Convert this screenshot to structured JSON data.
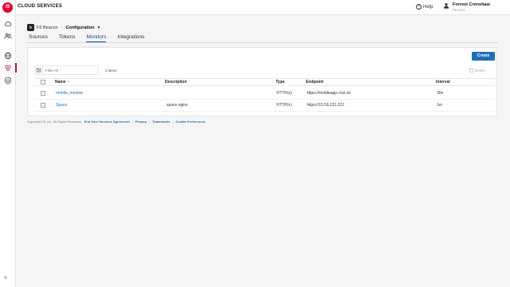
{
  "topbar": {
    "brand": "CLOUD SERVICES",
    "help_label": "Help",
    "user_name": "Forrest Crenshaw",
    "user_org": "F5 Acct"
  },
  "rail": {
    "logo_text": "f5",
    "icons": [
      "cloud-icon",
      "users-icon",
      "globe-icon",
      "beacon-icon",
      "shield-icon"
    ],
    "expand_label": "»"
  },
  "breadcrumb": {
    "product": "F5 Beacon",
    "section": "Configuration"
  },
  "tabs": [
    "Sources",
    "Tokens",
    "Monitors",
    "Integrations"
  ],
  "active_tab": "Monitors",
  "toolbar": {
    "create_label": "Create",
    "filter_placeholder": "Filter All",
    "item_count": "2 items",
    "delete_label": "Delete"
  },
  "table": {
    "columns": [
      "Name",
      "Description",
      "Type",
      "Endpoint",
      "Interval"
    ],
    "sort_indicator": "↑",
    "rows": [
      {
        "name": "mobile_monitor",
        "description": "",
        "type": "HTTP(s)",
        "endpoint": "https://mobileapp.r.ksi.io/",
        "interval": "30s"
      },
      {
        "name": "Space",
        "description": "space.nginx",
        "type": "HTTP(s)",
        "endpoint": "https://13.59.231.222",
        "interval": "1m"
      }
    ]
  },
  "footer": {
    "copyright": "Copyright F5, Inc. All Rights Reserved.",
    "links": [
      "End User Services Agreement",
      "Privacy",
      "Trademarks",
      "Cookie Preferences"
    ]
  },
  "colors": {
    "brand_red": "#e4002b",
    "accent_blue": "#1f6fb5",
    "active_tab": "#0b4f8a"
  }
}
